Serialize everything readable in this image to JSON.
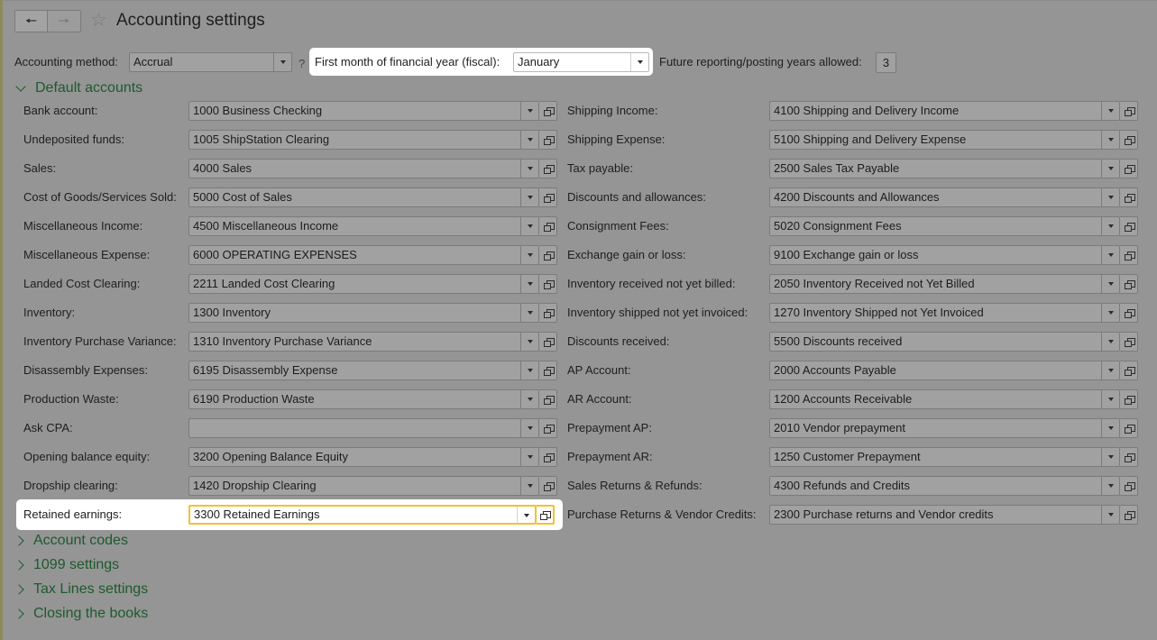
{
  "header": {
    "title": "Accounting settings"
  },
  "settings": {
    "accounting_method_label": "Accounting method:",
    "accounting_method_value": "Accrual",
    "help_mark": "?",
    "fiscal_label": "First month of financial year (fiscal):",
    "fiscal_value": "January",
    "future_years_label": "Future reporting/posting years allowed:",
    "future_years_value": "3"
  },
  "default_accounts": {
    "title": "Default accounts",
    "left": [
      {
        "label": "Bank account:",
        "value": "1000 Business Checking"
      },
      {
        "label": "Undeposited funds:",
        "value": "1005 ShipStation Clearing"
      },
      {
        "label": "Sales:",
        "value": "4000 Sales"
      },
      {
        "label": "Cost of Goods/Services Sold:",
        "value": "5000 Cost of Sales"
      },
      {
        "label": "Miscellaneous Income:",
        "value": "4500 Miscellaneous Income"
      },
      {
        "label": "Miscellaneous Expense:",
        "value": "6000 OPERATING EXPENSES"
      },
      {
        "label": "Landed Cost Clearing:",
        "value": "2211 Landed Cost Clearing"
      },
      {
        "label": "Inventory:",
        "value": "1300 Inventory"
      },
      {
        "label": "Inventory Purchase Variance:",
        "value": "1310 Inventory Purchase Variance"
      },
      {
        "label": "Disassembly Expenses:",
        "value": "6195 Disassembly Expense"
      },
      {
        "label": "Production Waste:",
        "value": "6190 Production Waste"
      },
      {
        "label": "Ask CPA:",
        "value": ""
      },
      {
        "label": "Opening balance equity:",
        "value": "3200 Opening Balance Equity"
      },
      {
        "label": "Dropship clearing:",
        "value": "1420 Dropship Clearing"
      },
      {
        "label": "Retained earnings:",
        "value": "3300 Retained Earnings"
      }
    ],
    "right": [
      {
        "label": "Shipping Income:",
        "value": "4100 Shipping and Delivery Income"
      },
      {
        "label": "Shipping Expense:",
        "value": "5100 Shipping and Delivery Expense"
      },
      {
        "label": "Tax payable:",
        "value": "2500 Sales Tax Payable"
      },
      {
        "label": "Discounts and allowances:",
        "value": "4200 Discounts and Allowances"
      },
      {
        "label": "Consignment Fees:",
        "value": "5020 Consignment Fees"
      },
      {
        "label": "Exchange gain or loss:",
        "value": "9100 Exchange gain or loss"
      },
      {
        "label": "Inventory received not yet billed:",
        "value": "2050 Inventory Received not Yet Billed"
      },
      {
        "label": "Inventory shipped not yet invoiced:",
        "value": "1270 Inventory Shipped not Yet Invoiced"
      },
      {
        "label": "Discounts received:",
        "value": "5500 Discounts received"
      },
      {
        "label": "AP Account:",
        "value": "2000 Accounts Payable"
      },
      {
        "label": "AR Account:",
        "value": "1200 Accounts Receivable"
      },
      {
        "label": "Prepayment AP:",
        "value": "2010 Vendor prepayment"
      },
      {
        "label": "Prepayment AR:",
        "value": "1250 Customer Prepayment"
      },
      {
        "label": "Sales Returns & Refunds:",
        "value": "4300 Refunds and Credits"
      },
      {
        "label": "Purchase Returns & Vendor Credits:",
        "value": "2300 Purchase returns and Vendor credits"
      }
    ]
  },
  "collapsed_groups": [
    "Account codes",
    "1099 settings",
    "Tax Lines settings",
    "Closing the books"
  ],
  "colors": {
    "overlay_bg": "#959595",
    "group_header": "#1d5a2d",
    "focus_border": "#f2c230"
  }
}
